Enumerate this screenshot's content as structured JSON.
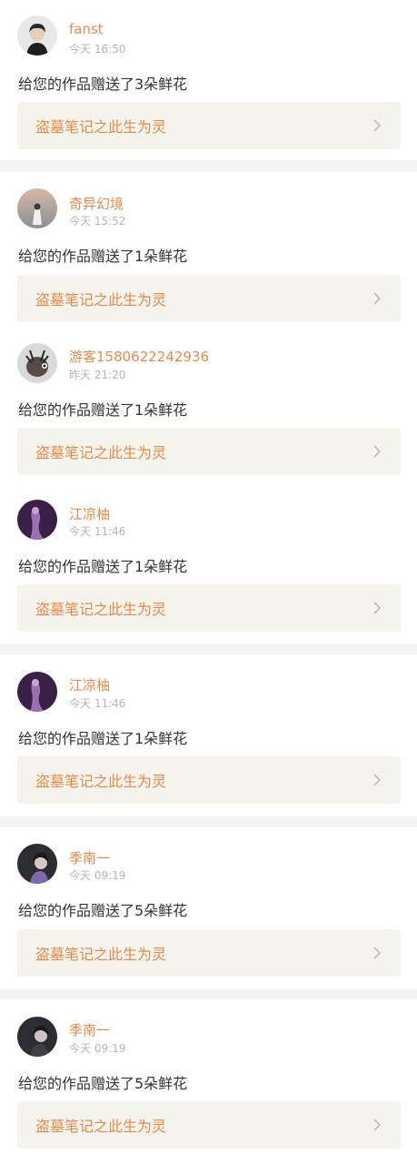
{
  "notifications": [
    {
      "username": "fanst",
      "time": "今天 16:50",
      "message": "给您的作品赠送了3朵鲜花",
      "work_title": "盗墓笔记之此生为灵",
      "avatar": "avatar-icon"
    },
    {
      "username": "奇异幻境",
      "time": "今天 15:52",
      "message": "给您的作品赠送了1朵鲜花",
      "work_title": "盗墓笔记之此生为灵",
      "avatar": "avatar-icon"
    },
    {
      "username": "游客1580622242936",
      "time": "昨天 21:20",
      "message": "给您的作品赠送了1朵鲜花",
      "work_title": "盗墓笔记之此生为灵",
      "avatar": "avatar-icon"
    },
    {
      "username": "江凉柚",
      "time": "今天 11:46",
      "message": "给您的作品赠送了1朵鲜花",
      "work_title": "盗墓笔记之此生为灵",
      "avatar": "avatar-icon"
    },
    {
      "username": "江凉柚",
      "time": "今天 11:46",
      "message": "给您的作品赠送了1朵鲜花",
      "work_title": "盗墓笔记之此生为灵",
      "avatar": "avatar-icon"
    },
    {
      "username": "季南一",
      "time": "今天 09:19",
      "message": "给您的作品赠送了5朵鲜花",
      "work_title": "盗墓笔记之此生为灵",
      "avatar": "avatar-icon"
    },
    {
      "username": "季南一",
      "time": "今天 09:19",
      "message": "给您的作品赠送了5朵鲜花",
      "work_title": "盗墓笔记之此生为灵",
      "avatar": "avatar-icon"
    }
  ],
  "colors": {
    "accent": "#e58a4a",
    "background": "#f4f4f4",
    "card": "#ffffff",
    "link_box": "#f4f3ec",
    "text": "#333333",
    "muted": "#b5b5b5"
  }
}
